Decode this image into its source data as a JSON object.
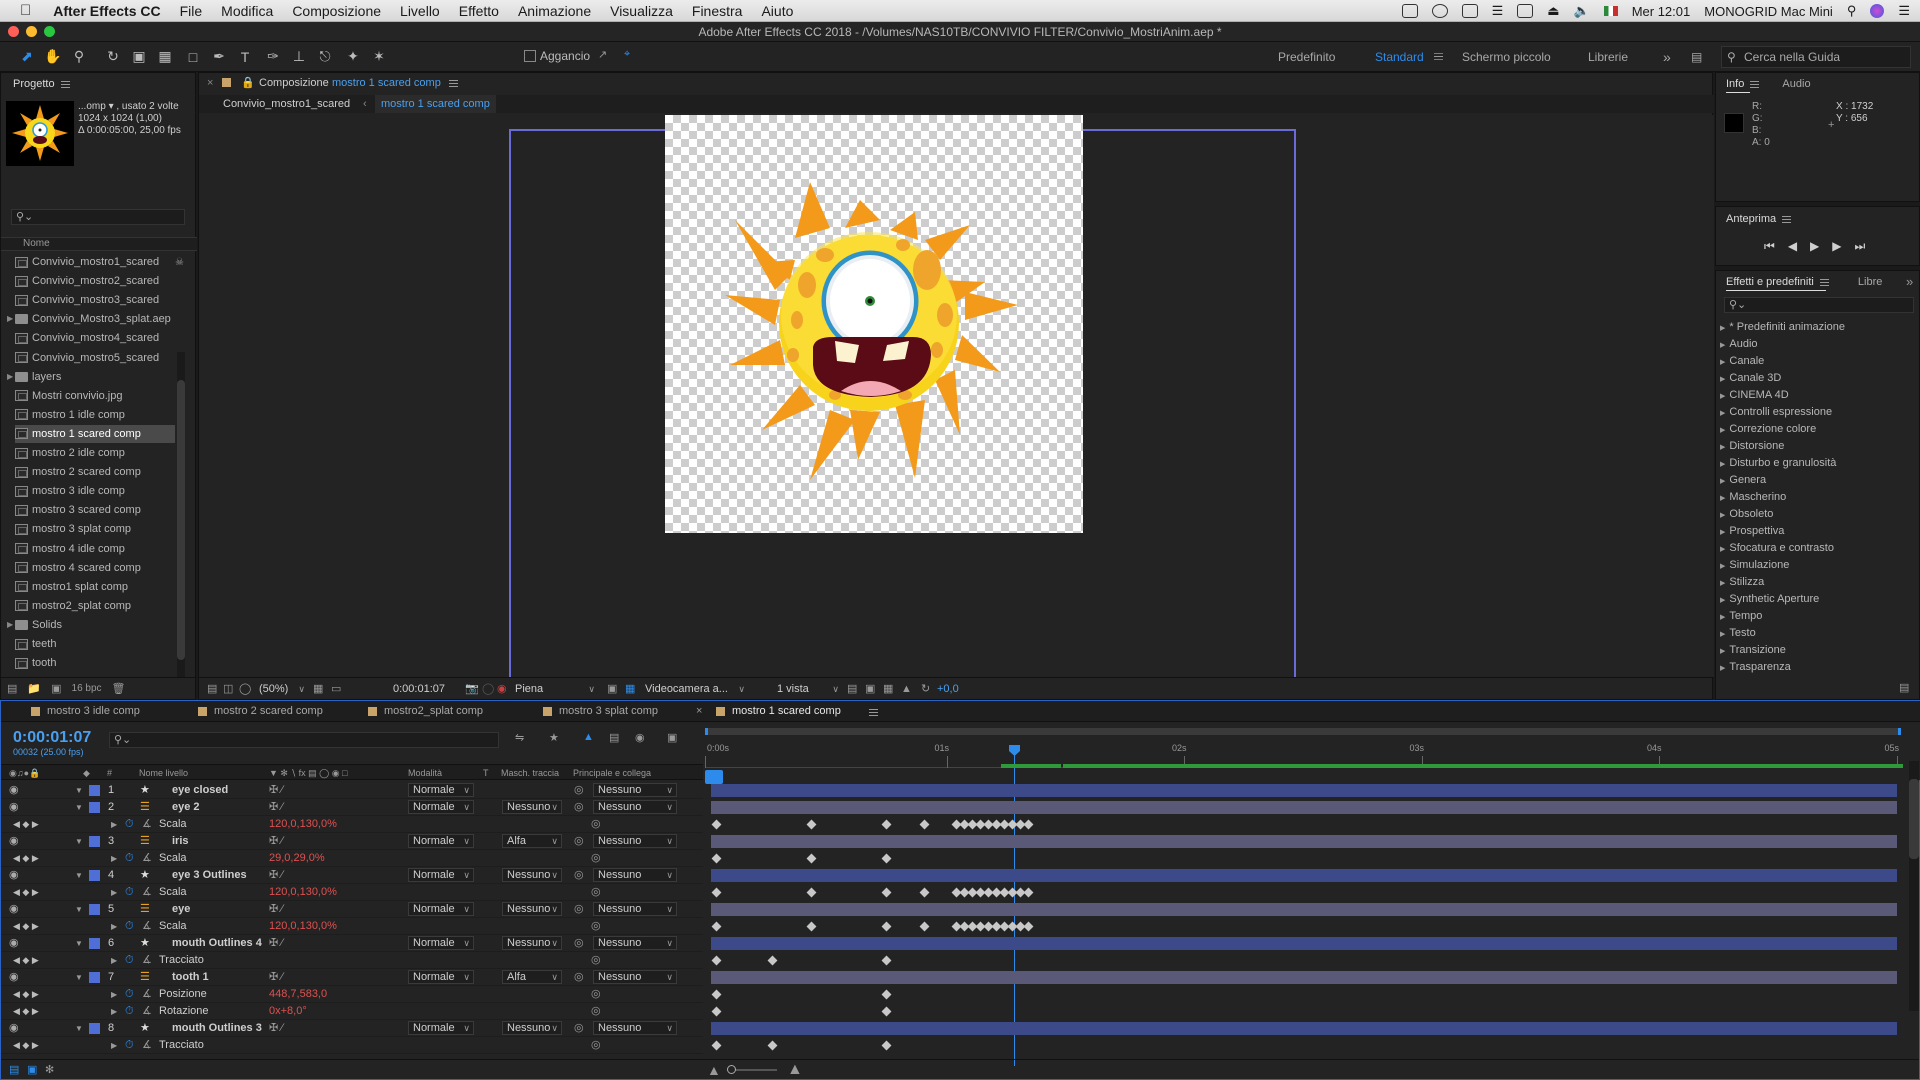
{
  "menubar": {
    "app": "After Effects CC",
    "items": [
      "File",
      "Modifica",
      "Composizione",
      "Livello",
      "Effetto",
      "Animazione",
      "Visualizza",
      "Finestra",
      "Aiuto"
    ],
    "time": "Mer 12:01",
    "machine": "MONOGRID Mac Mini"
  },
  "window_title": "Adobe After Effects CC 2018 - /Volumes/NAS10TB/CONVIVIO FILTER/Convivio_MostriAnim.aep *",
  "toolbar": {
    "snap_label": "Aggancio",
    "workspaces": [
      "Predefinito",
      "Standard",
      "Schermo piccolo",
      "Librerie"
    ],
    "active_workspace": "Standard",
    "search_placeholder": "Cerca nella Guida"
  },
  "project": {
    "title": "Progetto",
    "thumb_name": "...omp ▾ , usato 2 volte",
    "thumb_dims": "1024 x 1024 (1,00)",
    "thumb_duration": "Δ 0:00:05:00, 25,00 fps",
    "col_name": "Nome",
    "bpc": "16 bpc",
    "items": [
      {
        "name": "Convivio_mostro1_scared",
        "type": "comp"
      },
      {
        "name": "Convivio_mostro2_scared",
        "type": "comp"
      },
      {
        "name": "Convivio_mostro3_scared",
        "type": "comp"
      },
      {
        "name": "Convivio_Mostro3_splat.aep",
        "type": "folder"
      },
      {
        "name": "Convivio_mostro4_scared",
        "type": "comp"
      },
      {
        "name": "Convivio_mostro5_scared",
        "type": "comp"
      },
      {
        "name": "layers",
        "type": "folder"
      },
      {
        "name": "Mostri convivio.jpg",
        "type": "image"
      },
      {
        "name": "mostro 1 idle comp",
        "type": "comp"
      },
      {
        "name": "mostro 1 scared comp",
        "type": "comp"
      },
      {
        "name": "mostro 2 idle comp",
        "type": "comp"
      },
      {
        "name": "mostro 2 scared comp",
        "type": "comp"
      },
      {
        "name": "mostro 3 idle comp",
        "type": "comp"
      },
      {
        "name": "mostro 3 scared comp",
        "type": "comp"
      },
      {
        "name": "mostro 3 splat comp",
        "type": "comp"
      },
      {
        "name": "mostro 4 idle comp",
        "type": "comp"
      },
      {
        "name": "mostro 4 scared comp",
        "type": "comp"
      },
      {
        "name": "mostro1 splat comp",
        "type": "comp"
      },
      {
        "name": "mostro2_splat comp",
        "type": "comp"
      },
      {
        "name": "Solids",
        "type": "folder"
      },
      {
        "name": "teeth",
        "type": "comp"
      },
      {
        "name": "tooth",
        "type": "comp"
      }
    ],
    "selected": "mostro 1 scared comp"
  },
  "composition": {
    "label": "Composizione",
    "name": "mostro 1 scared comp",
    "breadcrumb": [
      "Convivio_mostro1_scared",
      "mostro 1 scared comp"
    ],
    "zoom": "(50%)",
    "timecode": "0:00:01:07",
    "resolution": "Piena",
    "camera": "Videocamera a...",
    "views": "1 vista",
    "exposure": "+0,0"
  },
  "info": {
    "tabs": [
      "Info",
      "Audio"
    ],
    "r": "R:",
    "g": "G:",
    "b": "B:",
    "a": "A:  0",
    "x": "X : 1732",
    "y": "Y : 656"
  },
  "preview": {
    "title": "Anteprima"
  },
  "effects": {
    "tabs": [
      "Effetti e predefiniti",
      "Libre"
    ],
    "items": [
      "* Predefiniti animazione",
      "Audio",
      "Canale",
      "Canale 3D",
      "CINEMA 4D",
      "Controlli espressione",
      "Correzione colore",
      "Distorsione",
      "Disturbo e granulosità",
      "Genera",
      "Mascherino",
      "Obsoleto",
      "Prospettiva",
      "Sfocatura e contrasto",
      "Simulazione",
      "Stilizza",
      "Synthetic Aperture",
      "Tempo",
      "Testo",
      "Transizione",
      "Trasparenza"
    ]
  },
  "timeline": {
    "tabs": [
      "mostro 3 idle comp",
      "mostro 2 scared comp",
      "mostro2_splat comp",
      "mostro 3 splat comp",
      "mostro 1 scared comp"
    ],
    "active_tab": "mostro 1 scared comp",
    "timecode": "0:00:01:07",
    "frames": "00032 (25.00 fps)",
    "headers": {
      "num": "#",
      "name": "Nome livello",
      "mode": "Modalità",
      "t": "T",
      "matte": "Masch. traccia",
      "parent": "Principale e collega"
    },
    "ruler": [
      "0:00s",
      "01s",
      "02s",
      "03s",
      "04s",
      "05s"
    ],
    "rows": [
      {
        "kind": "layer",
        "num": "1",
        "name": "eye closed",
        "icon": "star",
        "mode": "Normale",
        "matte": "",
        "parent": "Nessuno",
        "color": "#4f6fd6"
      },
      {
        "kind": "layer",
        "num": "2",
        "name": "eye 2",
        "icon": "img",
        "mode": "Normale",
        "matte": "Nessuno",
        "parent": "Nessuno",
        "color": "#4f6fd6"
      },
      {
        "kind": "prop",
        "name": "Scala",
        "value": "120,0,130,0%"
      },
      {
        "kind": "layer",
        "num": "3",
        "name": "iris",
        "icon": "img",
        "mode": "Normale",
        "matte": "Alfa",
        "parent": "Nessuno",
        "color": "#4f6fd6"
      },
      {
        "kind": "prop",
        "name": "Scala",
        "value": "29,0,29,0%"
      },
      {
        "kind": "layer",
        "num": "4",
        "name": "eye 3 Outlines",
        "icon": "star",
        "mode": "Normale",
        "matte": "Nessuno",
        "parent": "Nessuno",
        "color": "#4f6fd6"
      },
      {
        "kind": "prop",
        "name": "Scala",
        "value": "120,0,130,0%"
      },
      {
        "kind": "layer",
        "num": "5",
        "name": "eye",
        "icon": "img",
        "mode": "Normale",
        "matte": "Nessuno",
        "parent": "Nessuno",
        "color": "#4f6fd6"
      },
      {
        "kind": "prop",
        "name": "Scala",
        "value": "120,0,130,0%"
      },
      {
        "kind": "layer",
        "num": "6",
        "name": "mouth Outlines 4",
        "icon": "star",
        "mode": "Normale",
        "matte": "Nessuno",
        "parent": "Nessuno",
        "color": "#4f6fd6"
      },
      {
        "kind": "prop",
        "name": "Tracciato",
        "value": ""
      },
      {
        "kind": "layer",
        "num": "7",
        "name": "tooth 1",
        "icon": "img",
        "mode": "Normale",
        "matte": "Alfa",
        "parent": "Nessuno",
        "color": "#4f6fd6"
      },
      {
        "kind": "prop",
        "name": "Posizione",
        "value": "448,7,583,0"
      },
      {
        "kind": "prop",
        "name": "Rotazione",
        "value": "0x+8,0°"
      },
      {
        "kind": "layer",
        "num": "8",
        "name": "mouth Outlines 3",
        "icon": "star",
        "mode": "Normale",
        "matte": "Nessuno",
        "parent": "Nessuno",
        "color": "#4f6fd6"
      },
      {
        "kind": "prop",
        "name": "Tracciato",
        "value": ""
      }
    ]
  }
}
